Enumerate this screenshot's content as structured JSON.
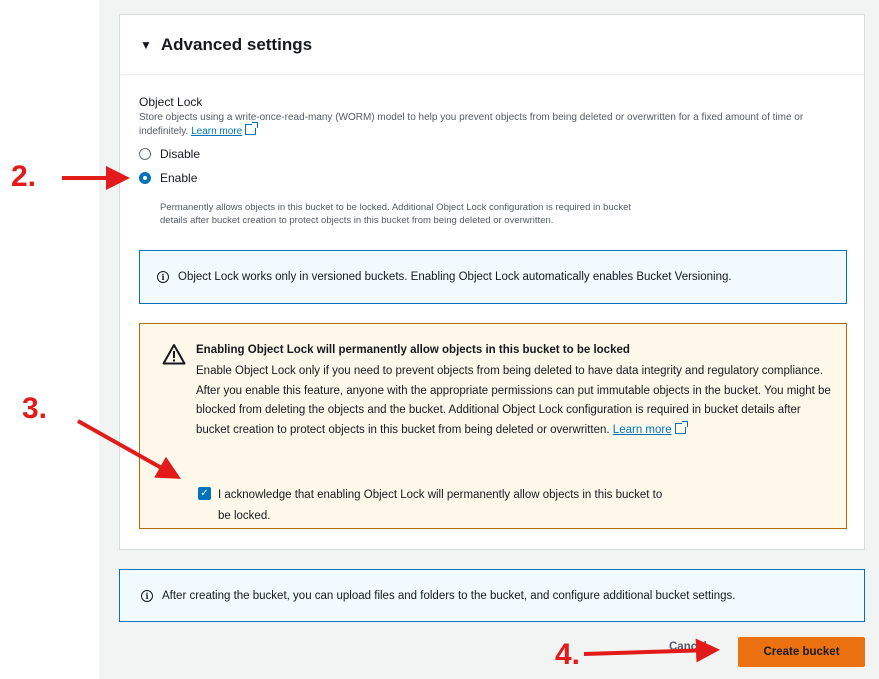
{
  "panel": {
    "title": "Advanced settings",
    "caret_icon": "caret-down-icon"
  },
  "object_lock": {
    "label": "Object Lock",
    "description": "Store objects using a write-once-read-many (WORM) model to help you prevent objects from being deleted or overwritten for a fixed amount of time or indefinitely.",
    "learn_more": "Learn more",
    "options": [
      {
        "label": "Disable",
        "selected": false
      },
      {
        "label": "Enable",
        "selected": true
      }
    ],
    "enable_description": "Permanently allows objects in this bucket to be locked. Additional Object Lock configuration is required in bucket details after bucket creation to protect objects in this bucket from being deleted or overwritten."
  },
  "info_box": {
    "text": "Object Lock works only in versioned buckets. Enabling Object Lock automatically enables Bucket Versioning."
  },
  "warning": {
    "title": "Enabling Object Lock will permanently allow objects in this bucket to be locked",
    "body": "Enable Object Lock only if you need to prevent objects from being deleted to have data integrity and regulatory compliance. After you enable this feature, anyone with the appropriate permissions can put immutable objects in the bucket. You might be blocked from deleting the objects and the bucket. Additional Object Lock configuration is required in bucket details after bucket creation to protect objects in this bucket from being deleted or overwritten.",
    "learn_more": "Learn more",
    "acknowledge_label": "I acknowledge that enabling Object Lock will permanently allow objects in this bucket to be locked.",
    "acknowledge_checked": true
  },
  "bottom_info": {
    "text": "After creating the bucket, you can upload files and folders to the bucket, and configure additional bucket settings."
  },
  "footer": {
    "cancel_label": "Cancel",
    "create_label": "Create bucket"
  },
  "annotations": {
    "step2": "2.",
    "step3": "3.",
    "step4": "4."
  },
  "colors": {
    "accent_blue": "#0073bb",
    "primary_orange": "#ec7211",
    "warning_border": "#b06c00",
    "annotation_red": "#e21a1a"
  }
}
